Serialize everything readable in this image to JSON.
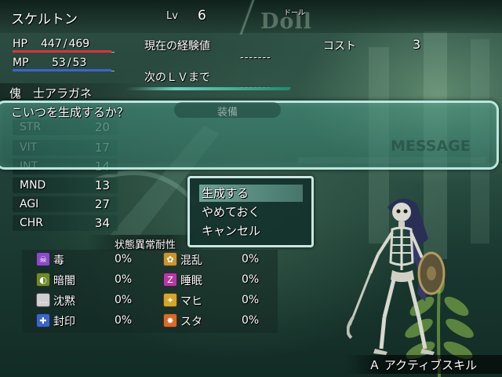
{
  "demon": {
    "name": "スケルトン",
    "level_label": "Lv",
    "level": "6",
    "race_en": "Doll",
    "race_ruby": "ドール",
    "subtitle": "傀　士アラガネ"
  },
  "vitals": {
    "hp_label": "HP",
    "hp_current": "447",
    "hp_max": "469",
    "mp_label": "MP",
    "mp_current": "53",
    "mp_max": "53",
    "separator": "/"
  },
  "experience": {
    "current_label": "現在の経験値",
    "current_value": "-------",
    "next_label": "次のＬＶまで",
    "next_value": "-------"
  },
  "cost": {
    "label": "コスト",
    "value": "3"
  },
  "message": {
    "text": "こいつを生成するか？",
    "watermark": "MESSAGE",
    "equip_tab": "装備"
  },
  "stats": [
    {
      "name": "STR",
      "value": "20",
      "dimmed": true
    },
    {
      "name": "VIT",
      "value": "17",
      "dimmed": true
    },
    {
      "name": "INT",
      "value": "14",
      "dimmed": true
    },
    {
      "name": "MND",
      "value": "13",
      "dimmed": false
    },
    {
      "name": "AGI",
      "value": "27",
      "dimmed": false
    },
    {
      "name": "CHR",
      "value": "34",
      "dimmed": false
    }
  ],
  "resistances": {
    "header": "状態異常耐性",
    "items": [
      {
        "name": "毒",
        "value": "0%",
        "icon": "poison-icon",
        "color": "#8a4bc8"
      },
      {
        "name": "混乱",
        "value": "0%",
        "icon": "confusion-icon",
        "color": "#c9962e"
      },
      {
        "name": "暗闇",
        "value": "0%",
        "icon": "darkness-icon",
        "color": "#6f8a2c"
      },
      {
        "name": "睡眠",
        "value": "0%",
        "icon": "sleep-icon",
        "color": "#b63aa4"
      },
      {
        "name": "沈黙",
        "value": "0%",
        "icon": "silence-icon",
        "color": "#cfcfcf"
      },
      {
        "name": "マヒ",
        "value": "0%",
        "icon": "paralysis-icon",
        "color": "#d5a62a"
      },
      {
        "name": "封印",
        "value": "0%",
        "icon": "seal-icon",
        "color": "#3a66c8"
      },
      {
        "name": "スタ",
        "value": "0%",
        "icon": "stun-icon",
        "color": "#d86a2a"
      }
    ]
  },
  "confirm_menu": {
    "items": [
      {
        "label": "生成する",
        "selected": true
      },
      {
        "label": "やめておく",
        "selected": false
      },
      {
        "label": "キャンセル",
        "selected": false
      }
    ]
  },
  "footer": {
    "skill_label": "Ａ アクティブスキル"
  },
  "colors": {
    "hp_bar": "#d83636",
    "mp_bar": "#3c62d8",
    "message_border": "#b9e8dd",
    "accent": "#7adccb"
  }
}
